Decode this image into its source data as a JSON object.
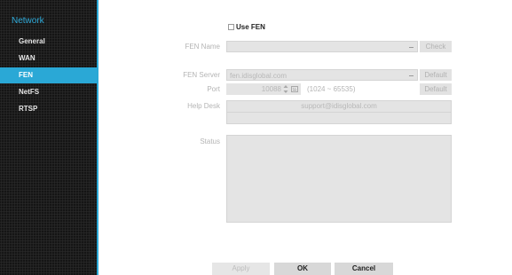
{
  "sidebar": {
    "title": "Network",
    "items": [
      {
        "label": "General"
      },
      {
        "label": "WAN"
      },
      {
        "label": "FEN"
      },
      {
        "label": "NetFS"
      },
      {
        "label": "RTSP"
      }
    ],
    "active": "FEN"
  },
  "fen": {
    "use_fen_label": "Use FEN",
    "use_fen_checked": false,
    "fen_name_label": "FEN Name",
    "fen_name_value": "",
    "check_label": "Check",
    "fen_server_label": "FEN Server",
    "fen_server_value": "fen.idisglobal.com",
    "server_default_label": "Default",
    "port_label": "Port",
    "port_value": "10088",
    "port_range": "(1024 ~ 65535)",
    "port_default_label": "Default",
    "help_desk_label": "Help Desk",
    "help_desk_value": "support@idisglobal.com",
    "help_desk_value2": "",
    "status_label": "Status",
    "status_value": ""
  },
  "footer": {
    "apply_label": "Apply",
    "ok_label": "OK",
    "cancel_label": "Cancel"
  },
  "colors": {
    "accent": "#2aa8d6",
    "sidebar_bg": "#1c1c1c"
  }
}
